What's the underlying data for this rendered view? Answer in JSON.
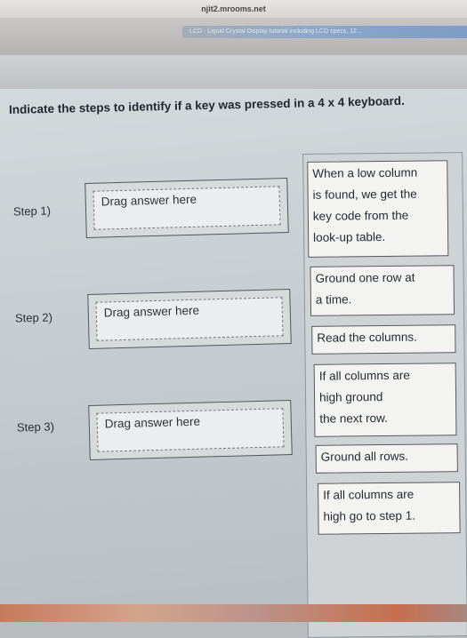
{
  "browser": {
    "url": "njit2.mrooms.net",
    "tab_title": "LCD - Liquid Crystal Display tutorial including LCD specs, 12..."
  },
  "question": "Indicate the steps to identify if a key was pressed in a 4 x 4 keyboard.",
  "steps": [
    {
      "label": "Step 1)",
      "drop_placeholder": "Drag answer here"
    },
    {
      "label": "Step 2)",
      "drop_placeholder": "Drag answer here"
    },
    {
      "label": "Step 3)",
      "drop_placeholder": "Drag answer here"
    }
  ],
  "options": [
    {
      "lines": [
        "When a low column",
        "is found, we get the",
        "key code from the",
        "look-up table."
      ]
    },
    {
      "lines": [
        "Ground one row at",
        "a time."
      ]
    },
    {
      "lines": [
        "Read the columns."
      ]
    },
    {
      "lines": [
        "If all columns are",
        "high ground",
        "the next row."
      ]
    },
    {
      "lines": [
        "Ground all rows."
      ]
    },
    {
      "lines": [
        "If all columns are",
        "high go to step 1."
      ]
    }
  ]
}
